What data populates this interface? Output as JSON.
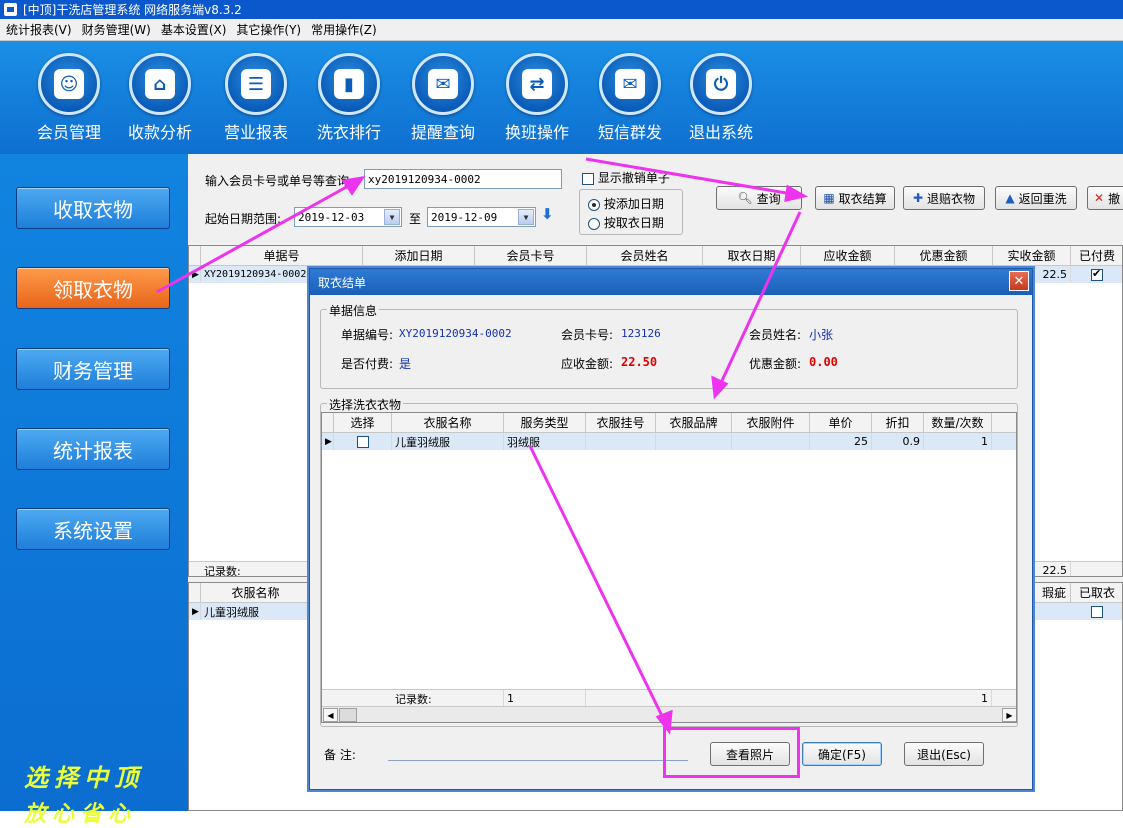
{
  "window": {
    "title": "[中顶]干洗店管理系统 网络服务端v8.3.2"
  },
  "menu": [
    "统计报表(V)",
    "财务管理(W)",
    "基本设置(X)",
    "其它操作(Y)",
    "常用操作(Z)"
  ],
  "toolbar": [
    {
      "label": "会员管理",
      "icon": "member-icon"
    },
    {
      "label": "收款分析",
      "icon": "home-icon"
    },
    {
      "label": "营业报表",
      "icon": "report-icon"
    },
    {
      "label": "洗衣排行",
      "icon": "bar-chart-icon"
    },
    {
      "label": "提醒查询",
      "icon": "chat-icon"
    },
    {
      "label": "换班操作",
      "icon": "swap-icon"
    },
    {
      "label": "短信群发",
      "icon": "sms-icon"
    },
    {
      "label": "退出系统",
      "icon": "power-icon"
    }
  ],
  "sidebar": [
    "收取衣物",
    "领取衣物",
    "财务管理",
    "统计报表",
    "系统设置"
  ],
  "slogan": {
    "line1": "选择中顶",
    "line2": "放心省心"
  },
  "search": {
    "label": "输入会员卡号或单号等查询:",
    "value": "xy2019120934-0002",
    "date_label": "起始日期范围:",
    "date_from": "2019-12-03",
    "to_label": "至",
    "date_to": "2019-12-09",
    "show_cancelled": "显示撤销单子",
    "radio_add": "按添加日期",
    "radio_take": "按取衣日期"
  },
  "buttons": {
    "query": "查询",
    "checkout": "取衣结算",
    "refund": "退赔衣物",
    "rewash": "返回重洗",
    "cancel": "撤"
  },
  "orders": {
    "headers": [
      "单据号",
      "添加日期",
      "会员卡号",
      "会员姓名",
      "取衣日期",
      "应收金额",
      "优惠金额",
      "实收金额",
      "已付费"
    ],
    "row": {
      "id": "XY2019120934-0002",
      "paid_amount": "22.5"
    },
    "footer_label": "记录数:",
    "footer_total": "22.5"
  },
  "items": {
    "headers": [
      "衣服名称",
      "瑕疵",
      "已取衣"
    ],
    "row": {
      "name": "儿童羽绒服"
    }
  },
  "dialog": {
    "title": "取衣结单",
    "info_group": "单据信息",
    "doc_no_label": "单据编号:",
    "doc_no": "XY2019120934-0002",
    "card_label": "会员卡号:",
    "card": "123126",
    "name_label": "会员姓名:",
    "name": "小张",
    "paid_label": "是否付费:",
    "paid": "是",
    "due_label": "应收金额:",
    "due": "22.50",
    "discount_label": "优惠金额:",
    "discount": "0.00",
    "select_group": "选择洗衣衣物",
    "grid_headers": [
      "选择",
      "衣服名称",
      "服务类型",
      "衣服挂号",
      "衣服品牌",
      "衣服附件",
      "单价",
      "折扣",
      "数量/次数"
    ],
    "grid_row": {
      "name": "儿童羽绒服",
      "service": "羽绒服",
      "price": "25",
      "discount": "0.9",
      "qty": "1"
    },
    "footer_label": "记录数:",
    "footer_count": "1",
    "footer_qty": "1",
    "remark_label": "备    注:",
    "btn_photo": "查看照片",
    "btn_ok": "确定(F5)",
    "btn_exit": "退出(Esc)"
  },
  "colors": {
    "accent": "#0e6fd0",
    "active": "#e8651a",
    "annotation": "#ee33ee"
  }
}
